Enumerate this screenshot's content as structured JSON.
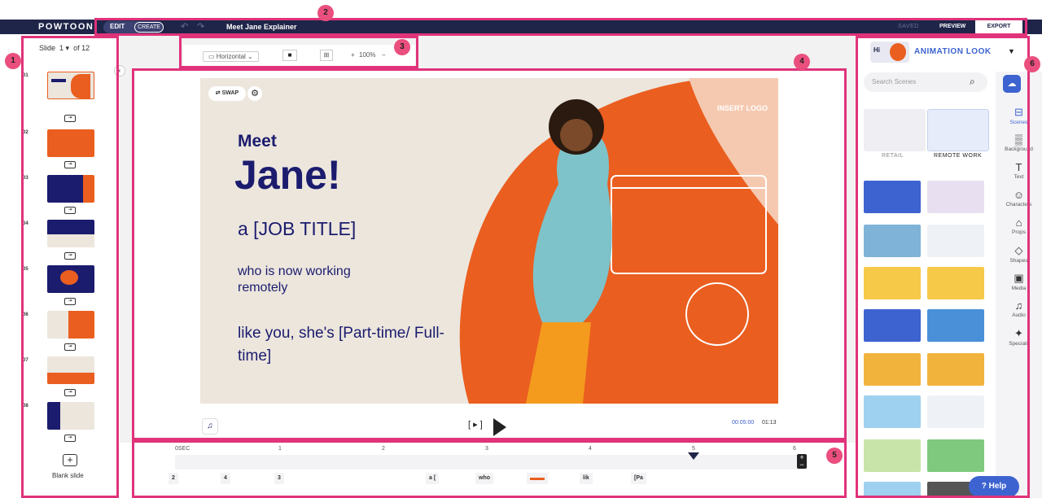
{
  "app": {
    "logo": "POWTOON",
    "mode_edit": "EDIT",
    "mode_create": "CREATE",
    "project_title": "Meet Jane Explainer",
    "saved": "SAVED",
    "preview": "PREVIEW",
    "export": "EXPORT"
  },
  "badges": [
    "1",
    "2",
    "3",
    "4",
    "5",
    "6"
  ],
  "slides": {
    "label": "Slide",
    "current": "1 ▾",
    "of": "of 12",
    "nums": [
      "01",
      "02",
      "03",
      "04",
      "05",
      "06",
      "07",
      "08"
    ],
    "blank": "Blank slide",
    "blank_icon": "+"
  },
  "toolbar": {
    "orientation": "Horizontal",
    "zoom_plus": "+",
    "zoom": "100%",
    "zoom_minus": "−"
  },
  "slide": {
    "swap": "⇄ SWAP",
    "line1": "Meet",
    "line2": "Jane!",
    "line3": "a [JOB TITLE]",
    "line4": "who is now working remotely",
    "line5": "like you, she's [Part-time/ Full-time]",
    "logo": "INSERT LOGO"
  },
  "player": {
    "play": "[ ▸ ]",
    "current": "00:05:00",
    "total": "01:13"
  },
  "timeline": {
    "marks": [
      "0SEC",
      "1",
      "2",
      "3",
      "4",
      "5",
      "6"
    ],
    "items": [
      "2",
      "4",
      "3",
      "a [",
      "who",
      "",
      "lik",
      "[Pa"
    ]
  },
  "right": {
    "title": "ANIMATION LOOK",
    "search_placeholder": "Search Scenes",
    "cat1": "RETAIL",
    "cat2": "REMOTE WORK",
    "help": "? Help"
  },
  "sidebar": [
    "Scenes",
    "Background",
    "Text",
    "Characters",
    "Props",
    "Shapes",
    "Media",
    "Audio",
    "Specials"
  ],
  "colors": {
    "navy": "#1f2548",
    "pink": "#e0337a",
    "orange": "#ea5e1f",
    "blue": "#3d63d0"
  }
}
